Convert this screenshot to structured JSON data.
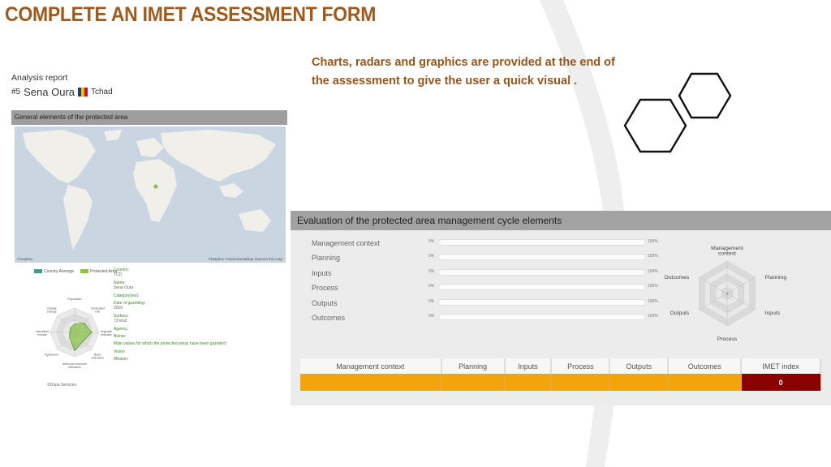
{
  "slide": {
    "title": "COMPLETE AN IMET ASSESSMENT FORM",
    "caption": "Charts, radars and graphics are provided  at the end of the assessment to give the user a quick visual ."
  },
  "colors": {
    "title": "#a05a1c",
    "caption": "#9a5418",
    "bar": "#f3a40b",
    "imet": "#8b0000",
    "legend_country": "#3aa08c",
    "legend_protected": "#8ac24a"
  },
  "report": {
    "title": "Analysis report",
    "number": "#5",
    "area_name": "Sena Oura",
    "country": "Tchad",
    "flag_colors": [
      "#1b3a8c",
      "#f2c200",
      "#c8102e"
    ],
    "band_label": "General elements of the protected area",
    "map_credit": "©Mapbox ©OpenStreetMap Improve this map",
    "map_logo": "©mapbox",
    "legend": [
      "Country Average",
      "Protected Area"
    ],
    "radar_labels": [
      "Population",
      "Generated KIE",
      "Vegetation indicators",
      "Basic indicators",
      "Anthropic pressure indicators",
      "Agriculture",
      "Intensified threats",
      "Climate change"
    ],
    "info": [
      {
        "label": "Country:",
        "value": "TCD"
      },
      {
        "label": "Name:",
        "value": "Sena Oura"
      },
      {
        "label": "Category(ies):",
        "value": ""
      },
      {
        "label": "Date of gazetting:",
        "value": "2010"
      },
      {
        "label": "Surface:",
        "value": "73 km2"
      },
      {
        "label": "Agency:",
        "value": ""
      },
      {
        "label": "Biome:",
        "value": ""
      },
      {
        "label": "Main values for which the protected areas have been gazetted:",
        "value": ""
      },
      {
        "label": "Vision:",
        "value": ""
      },
      {
        "label": "Mission:",
        "value": ""
      }
    ],
    "copyright": "©Dopa Services"
  },
  "evaluation": {
    "title": "Evaluation of the protected area management cycle elements",
    "rows": [
      {
        "label": "Management context",
        "min": "0%",
        "max": "100%",
        "value": 0
      },
      {
        "label": "Planning",
        "min": "0%",
        "max": "100%",
        "value": 0
      },
      {
        "label": "Inputs",
        "min": "0%",
        "max": "100%",
        "value": 0
      },
      {
        "label": "Process",
        "min": "0%",
        "max": "100%",
        "value": 0
      },
      {
        "label": "Outputs",
        "min": "0%",
        "max": "100%",
        "value": 0
      },
      {
        "label": "Outcomes",
        "min": "0%",
        "max": "100%",
        "value": 0
      }
    ],
    "radar": {
      "axes": [
        "Management context",
        "Planning",
        "Inputs",
        "Process",
        "Outputs",
        "Outcomes"
      ],
      "center_label": "0"
    },
    "table": {
      "headers": [
        "Management context",
        "Planning",
        "Inputs",
        "Process",
        "Outputs",
        "Outcomes",
        "IMET index"
      ],
      "values": [
        "",
        "",
        "",
        "",
        "",
        "",
        "0"
      ]
    }
  }
}
